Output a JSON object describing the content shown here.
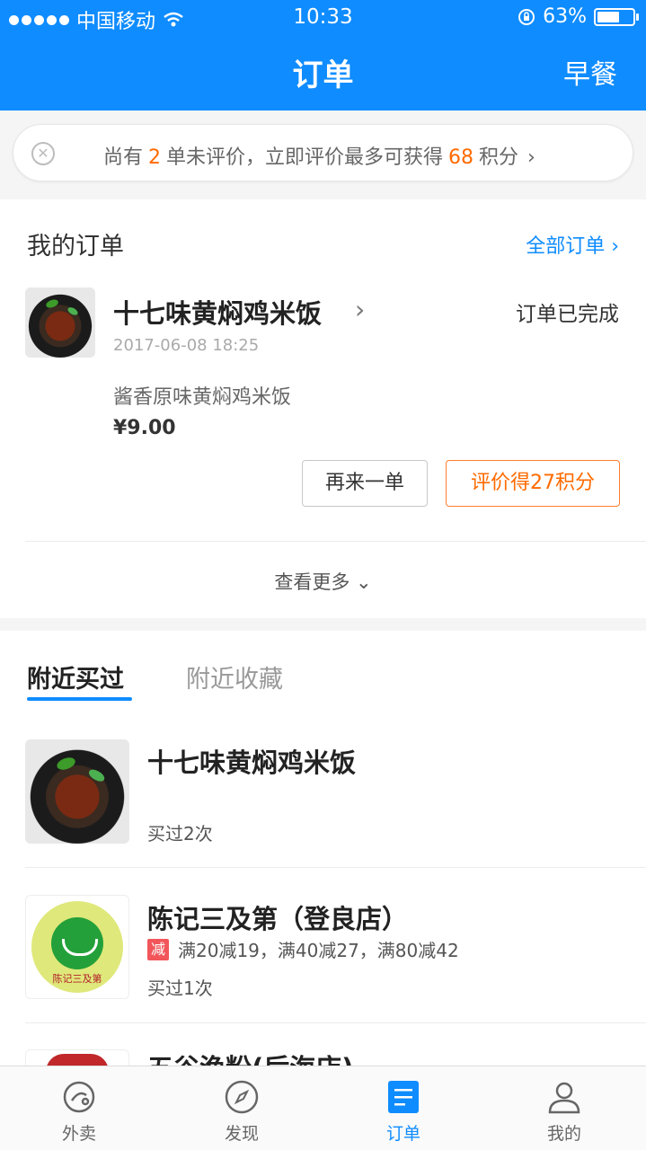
{
  "status_bar": {
    "carrier": "中国移动",
    "time": "10:33",
    "battery": "63%",
    "battery_level": 0.63
  },
  "nav": {
    "title": "订单",
    "right": "早餐"
  },
  "notice": {
    "prefix": "尚有",
    "count": "2",
    "middle": "单未评价，立即评价最多可获得",
    "points": "68",
    "suffix": "积分",
    "arrow": "›"
  },
  "orders": {
    "title": "我的订单",
    "all_link": "全部订单 ›",
    "order": {
      "shop": "十七味黄焖鸡米饭",
      "status": "订单已完成",
      "time": "2017-06-08 18:25",
      "item": "酱香原味黄焖鸡米饭",
      "price": "¥9.00",
      "again_button": "再来一单",
      "rate_button": "评价得27积分"
    },
    "more": "查看更多 ⌄"
  },
  "nearby": {
    "tabs": [
      "附近买过",
      "附近收藏"
    ],
    "shops": [
      {
        "name": "十七味黄焖鸡米饭",
        "bought": "买过2次"
      },
      {
        "name": "陈记三及第（登良店）",
        "promo_tag": "减",
        "promo": "满20减19，满40减27，满80减42",
        "bought": "买过1次",
        "logo_text": "陈记三及第"
      },
      {
        "name": "五谷渔粉(后海店)"
      }
    ]
  },
  "tabbar": {
    "items": [
      "外卖",
      "发现",
      "订单",
      "我的"
    ]
  },
  "colors": {
    "primary": "#0f8cff",
    "accent": "#ff6a00"
  }
}
